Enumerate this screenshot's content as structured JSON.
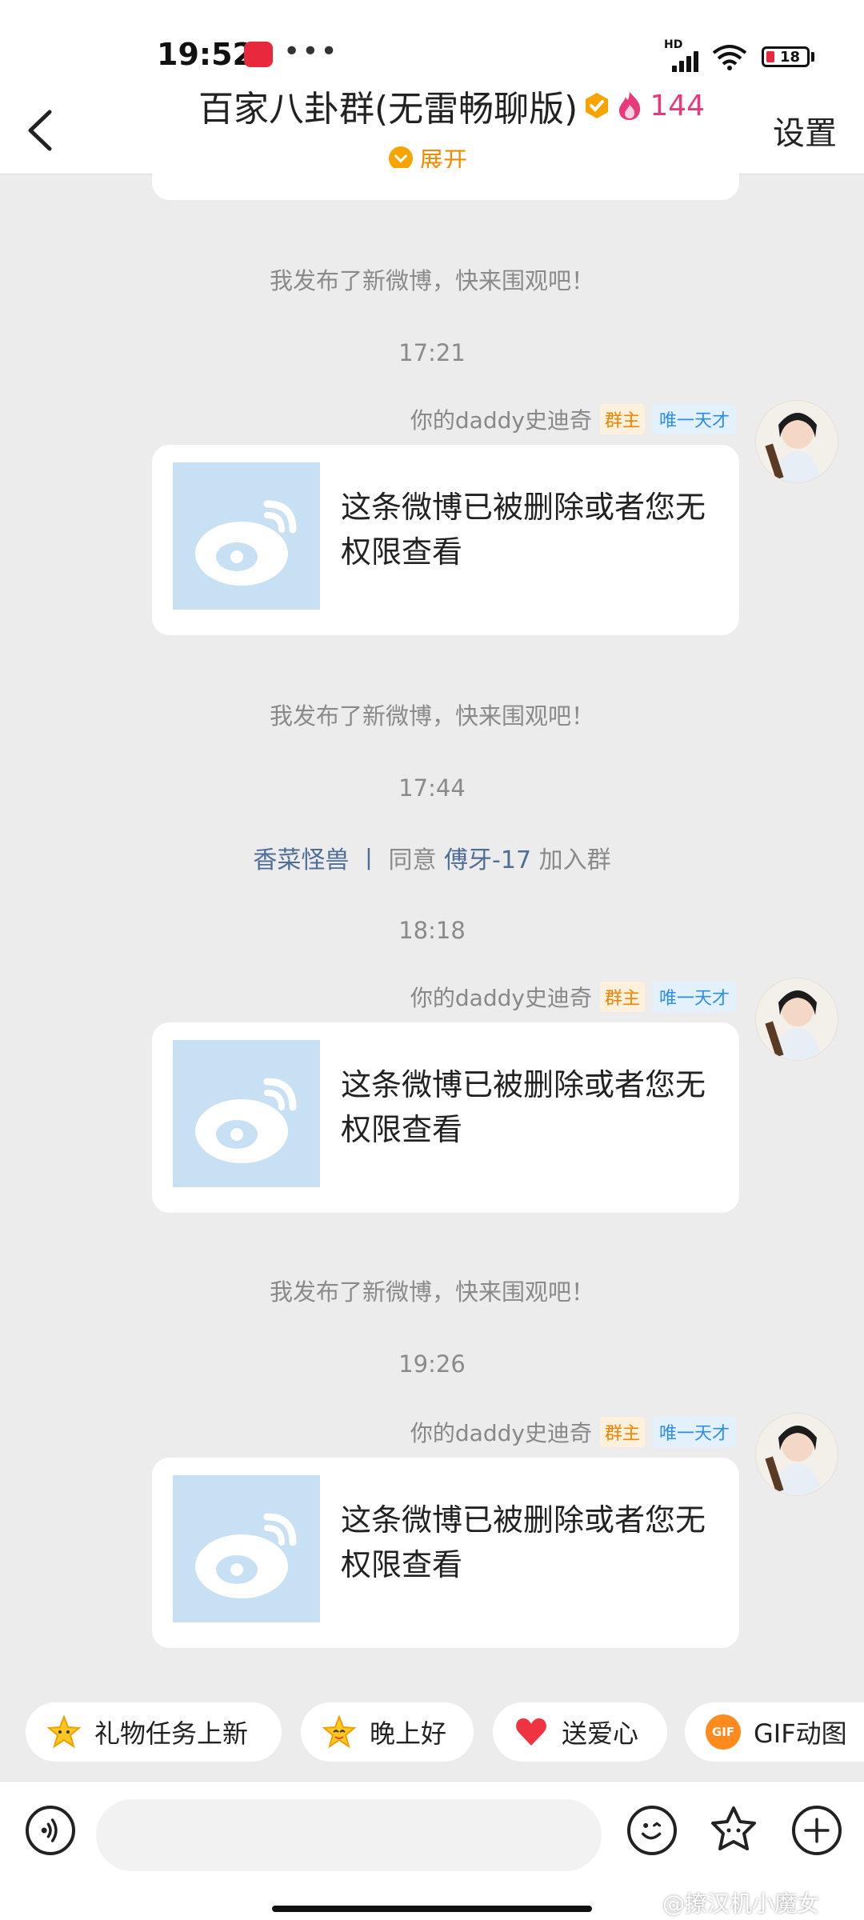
{
  "status_bar": {
    "time": "19:52",
    "dots": "•••",
    "network": "HD",
    "battery": "18"
  },
  "header": {
    "title": "百家八卦群(无雷畅聊版)",
    "member_count": "144",
    "expand_label": "展开",
    "settings_label": "设置",
    "back_icon": "chevron-left-icon",
    "accent_color": "#e8397a"
  },
  "chat": {
    "items": [
      {
        "type": "system",
        "text": "我发布了新微博，快来围观吧！"
      },
      {
        "type": "time",
        "text": "17:21"
      },
      {
        "type": "message",
        "sender": "你的daddy史迪奇",
        "role_badge": "群主",
        "title_badge": "唯一天才",
        "card_text": "这条微博已被删除或者您无权限查看"
      },
      {
        "type": "system",
        "text": "我发布了新微博，快来围观吧！"
      },
      {
        "type": "time",
        "text": "17:44"
      },
      {
        "type": "join",
        "actor": "香菜怪兽",
        "separator": "丨",
        "verb": "同意",
        "target": "傅牙-17",
        "suffix": "加入群"
      },
      {
        "type": "time",
        "text": "18:18"
      },
      {
        "type": "message",
        "sender": "你的daddy史迪奇",
        "role_badge": "群主",
        "title_badge": "唯一天才",
        "card_text": "这条微博已被删除或者您无权限查看"
      },
      {
        "type": "system",
        "text": "我发布了新微博，快来围观吧！"
      },
      {
        "type": "time",
        "text": "19:26"
      },
      {
        "type": "message",
        "sender": "你的daddy史迪奇",
        "role_badge": "群主",
        "title_badge": "唯一天才",
        "card_text": "这条微博已被删除或者您无权限查看"
      }
    ]
  },
  "quick_replies": [
    {
      "label": "礼物任务上新",
      "icon": "star-icon"
    },
    {
      "label": "晚上好",
      "icon": "star-face-icon"
    },
    {
      "label": "送爱心",
      "icon": "heart-icon"
    },
    {
      "label": "GIF动图",
      "icon": "gif-icon",
      "icon_text": "GIF"
    }
  ],
  "input": {
    "placeholder": ""
  },
  "watermark": "@撩汉机小魔女"
}
